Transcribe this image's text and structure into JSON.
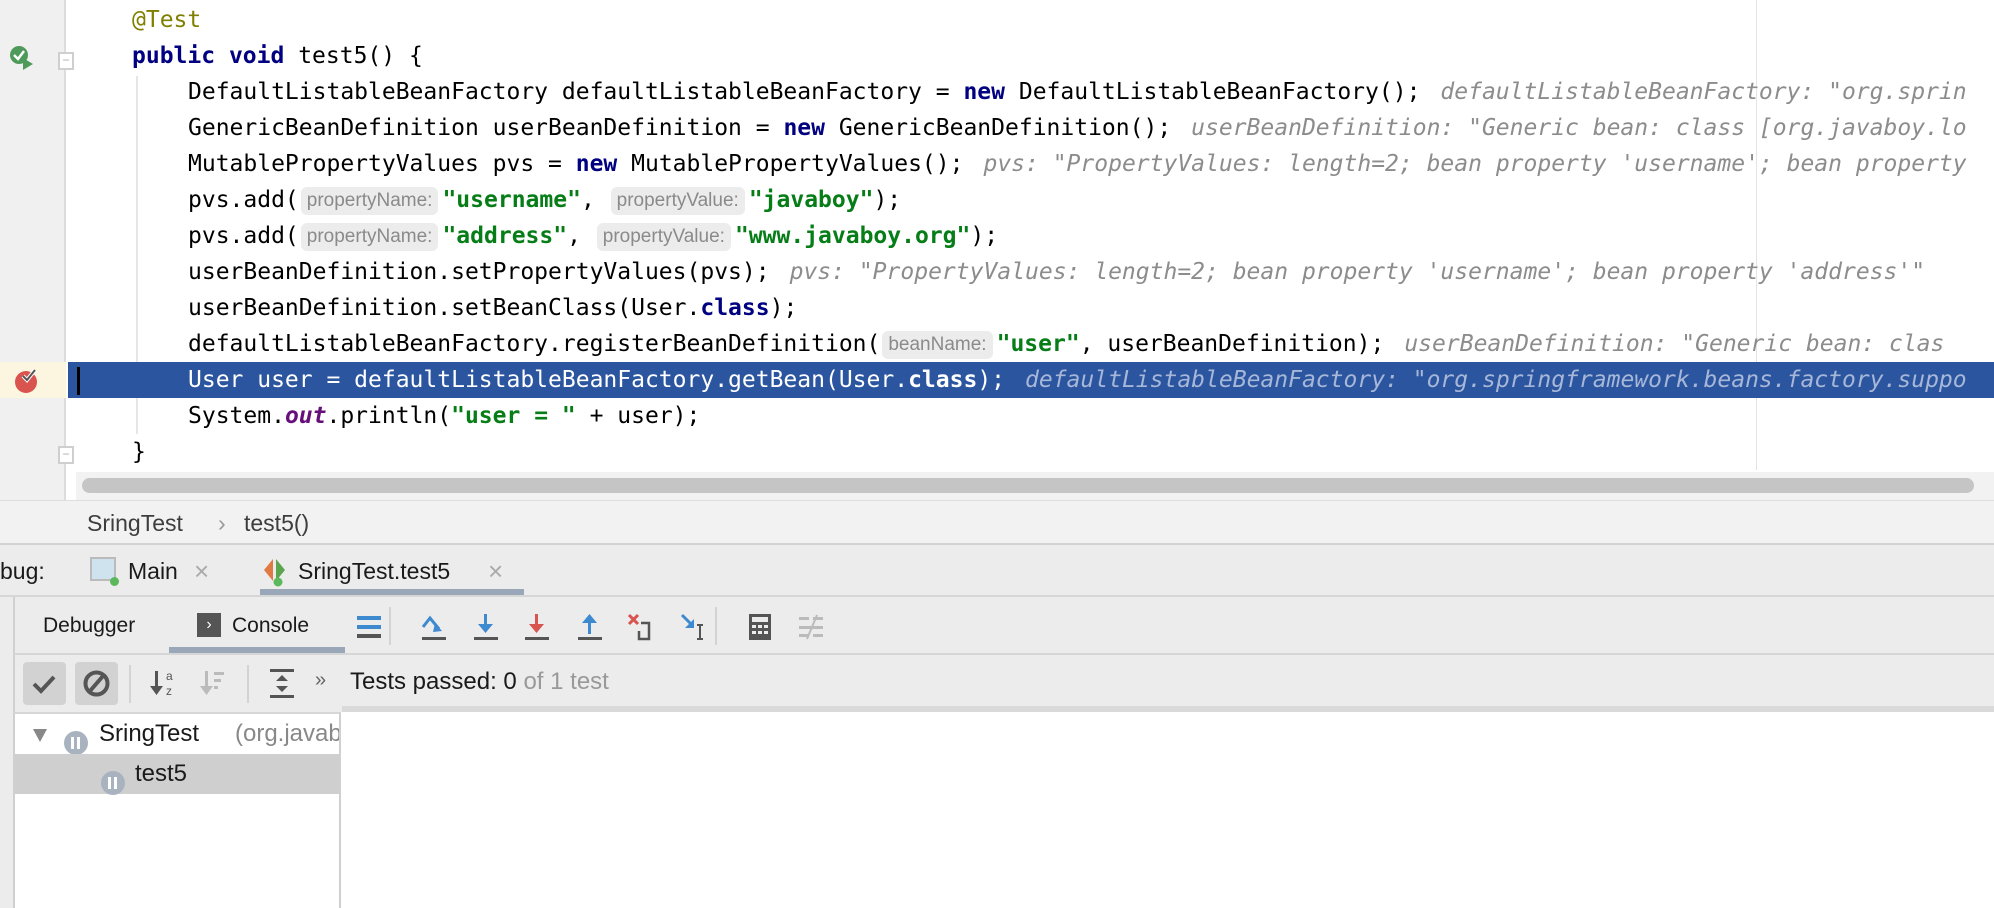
{
  "editor": {
    "lines": [
      {
        "indent": 1,
        "tokens": [
          {
            "c": "ann",
            "t": "@Test"
          }
        ]
      },
      {
        "indent": 1,
        "tokens": [
          {
            "c": "kw",
            "t": "public"
          },
          {
            "c": "",
            "t": " "
          },
          {
            "c": "kw",
            "t": "void"
          },
          {
            "c": "",
            "t": " test5() {"
          }
        ]
      },
      {
        "indent": 2,
        "tokens": [
          {
            "c": "",
            "t": "DefaultListableBeanFactory defaultListableBeanFactory = "
          },
          {
            "c": "kw",
            "t": "new"
          },
          {
            "c": "",
            "t": " DefaultListableBeanFactory();"
          },
          {
            "c": "hint",
            "t": "defaultListableBeanFactory: \"org.sprin"
          }
        ]
      },
      {
        "indent": 2,
        "tokens": [
          {
            "c": "",
            "t": "GenericBeanDefinition userBeanDefinition = "
          },
          {
            "c": "kw",
            "t": "new"
          },
          {
            "c": "",
            "t": " GenericBeanDefinition();"
          },
          {
            "c": "hint",
            "t": "userBeanDefinition: \"Generic bean: class [org.javaboy.lo"
          }
        ]
      },
      {
        "indent": 2,
        "tokens": [
          {
            "c": "",
            "t": "MutablePropertyValues pvs = "
          },
          {
            "c": "kw",
            "t": "new"
          },
          {
            "c": "",
            "t": " MutablePropertyValues();"
          },
          {
            "c": "hint",
            "t": "pvs: \"PropertyValues: length=2; bean property 'username'; bean property"
          }
        ]
      },
      {
        "indent": 2,
        "tokens": [
          {
            "c": "",
            "t": "pvs.add("
          },
          {
            "c": "phint",
            "t": "propertyName:"
          },
          {
            "c": "str",
            "t": "\"username\""
          },
          {
            "c": "",
            "t": ", "
          },
          {
            "c": "phint",
            "t": "propertyValue:"
          },
          {
            "c": "str",
            "t": "\"javaboy\""
          },
          {
            "c": "",
            "t": ");"
          }
        ]
      },
      {
        "indent": 2,
        "tokens": [
          {
            "c": "",
            "t": "pvs.add("
          },
          {
            "c": "phint",
            "t": "propertyName:"
          },
          {
            "c": "str",
            "t": "\"address\""
          },
          {
            "c": "",
            "t": ", "
          },
          {
            "c": "phint",
            "t": "propertyValue:"
          },
          {
            "c": "str",
            "t": "\"www.javaboy.org\""
          },
          {
            "c": "",
            "t": ");"
          }
        ]
      },
      {
        "indent": 2,
        "tokens": [
          {
            "c": "",
            "t": "userBeanDefinition.setPropertyValues(pvs);"
          },
          {
            "c": "hint",
            "t": "pvs: \"PropertyValues: length=2; bean property 'username'; bean property 'address'\""
          }
        ]
      },
      {
        "indent": 2,
        "tokens": [
          {
            "c": "",
            "t": "userBeanDefinition.setBeanClass(User."
          },
          {
            "c": "kw",
            "t": "class"
          },
          {
            "c": "",
            "t": ");"
          }
        ]
      },
      {
        "indent": 2,
        "tokens": [
          {
            "c": "",
            "t": "defaultListableBeanFactory.registerBeanDefinition("
          },
          {
            "c": "phint",
            "t": "beanName:"
          },
          {
            "c": "str",
            "t": "\"user\""
          },
          {
            "c": "",
            "t": ", userBeanDefinition);"
          },
          {
            "c": "hint",
            "t": "userBeanDefinition: \"Generic bean: clas"
          }
        ]
      },
      {
        "indent": 2,
        "highlight": true,
        "tokens": [
          {
            "c": "",
            "t": "User user = defaultListableBeanFactory.getBean(User."
          },
          {
            "c": "kw",
            "t": "class"
          },
          {
            "c": "",
            "t": ");"
          },
          {
            "c": "hint",
            "t": "defaultListableBeanFactory: \"org.springframework.beans.factory.suppo"
          }
        ]
      },
      {
        "indent": 2,
        "tokens": [
          {
            "c": "",
            "t": "System."
          },
          {
            "c": "sf",
            "t": "out"
          },
          {
            "c": "",
            "t": ".println("
          },
          {
            "c": "str",
            "t": "\"user = \""
          },
          {
            "c": "",
            "t": " + user);"
          }
        ]
      },
      {
        "indent": 1,
        "tokens": [
          {
            "c": "",
            "t": "}"
          }
        ]
      }
    ]
  },
  "breadcrumb": {
    "class": "SringTest",
    "separator": "›",
    "method": "test5()"
  },
  "debug_tabs": {
    "label": "bug:",
    "tabs": [
      {
        "label": "Main",
        "close": "×"
      },
      {
        "label": "SringTest.test5",
        "close": "×",
        "active": true
      }
    ]
  },
  "toolbar": {
    "debugger": "Debugger",
    "console": "Console"
  },
  "test_bar": {
    "more": "»",
    "status_prefix": "Tests passed: ",
    "passed": "0",
    "status_suffix": " of 1 test"
  },
  "tree": {
    "root": {
      "name": "SringTest",
      "package": "(org.javab"
    },
    "child": {
      "name": "test5"
    }
  },
  "colors": {
    "highlight": "#2c55a0",
    "string": "#067d17",
    "keyword": "#000080"
  }
}
